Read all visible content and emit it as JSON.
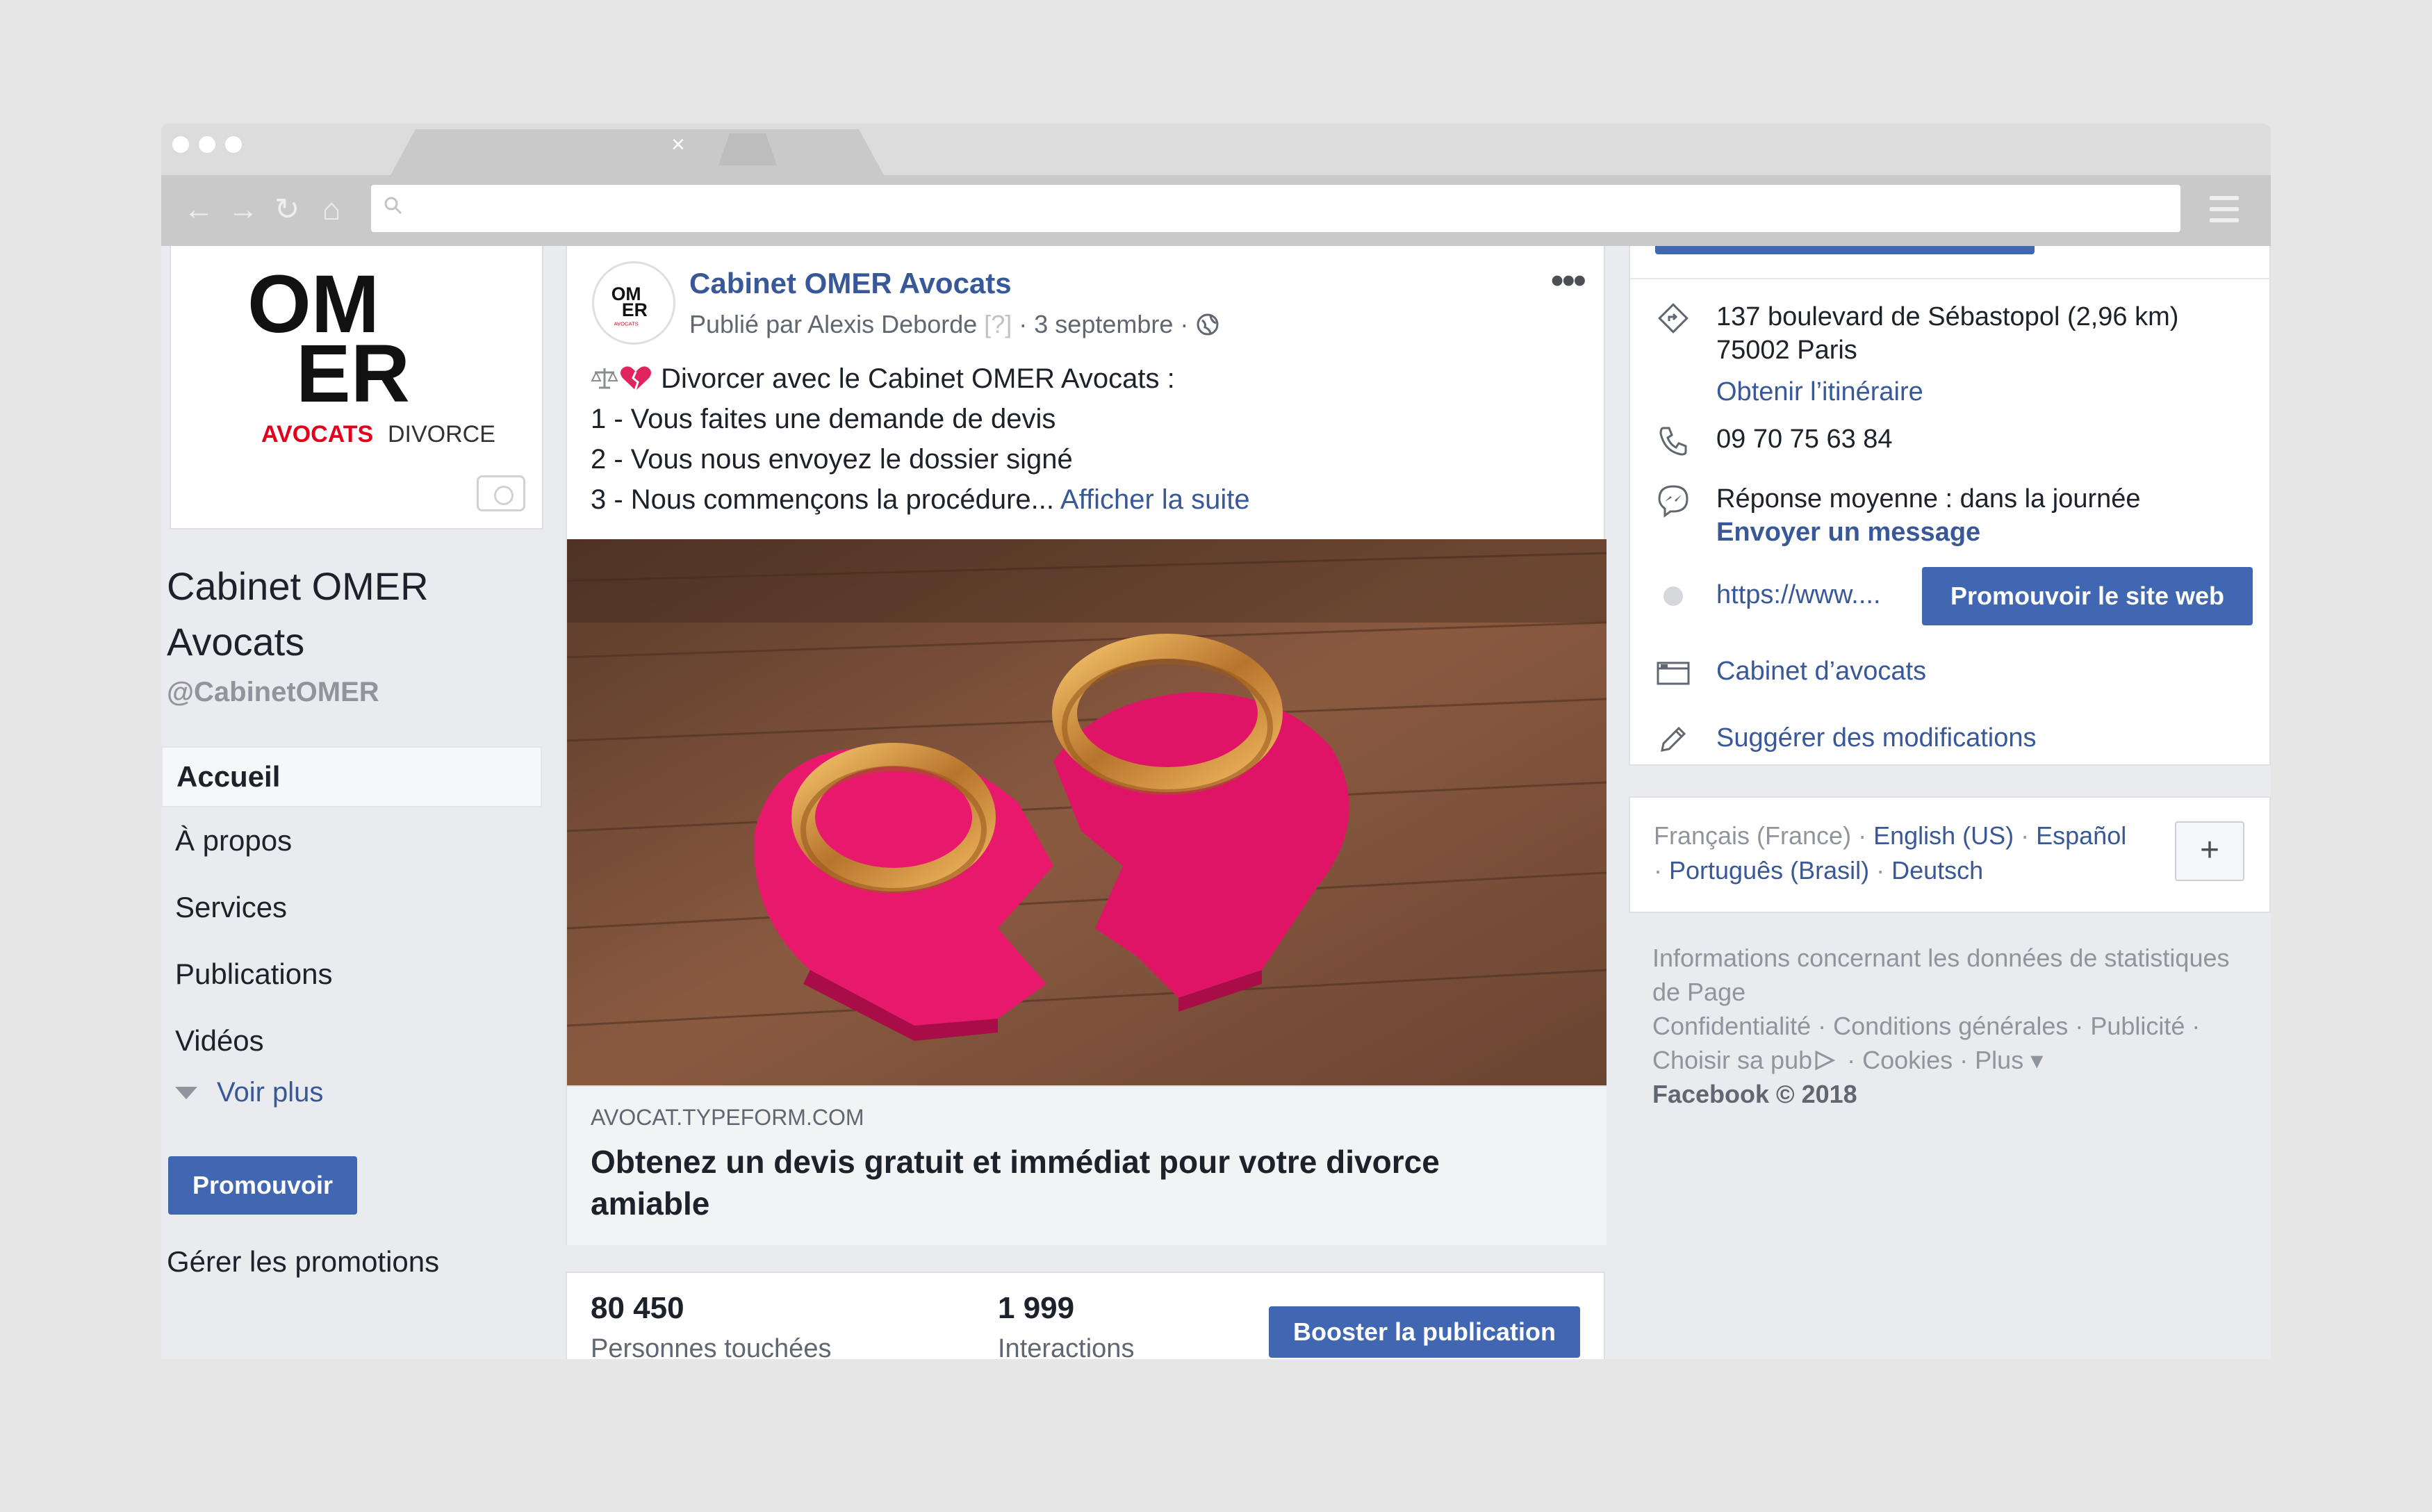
{
  "browser": {
    "tab_close": "×"
  },
  "page": {
    "name": "Cabinet OMER Avocats",
    "handle": "@CabinetOMER",
    "logo": {
      "line1": "OM",
      "line2": "ER",
      "word_red": "AVOCATS",
      "word_black": "DIVORCE"
    }
  },
  "sidebar": {
    "items": [
      {
        "label": "Accueil"
      },
      {
        "label": "À propos"
      },
      {
        "label": "Services"
      },
      {
        "label": "Publications"
      },
      {
        "label": "Vidéos"
      }
    ],
    "see_more": "Voir plus",
    "promote_label": "Promouvoir",
    "manage_promotions": "Gérer les promotions"
  },
  "post": {
    "author": "Cabinet OMER Avocats",
    "published_by": "Publié par Alexis Deborde",
    "help_mark": "[?]",
    "separator": "·",
    "date": "3 septembre",
    "more_menu": "•••",
    "lines": [
      "Divorcer avec le Cabinet OMER Avocats :",
      "1 - Vous faites une demande de devis",
      "2 - Vous nous envoyez le dossier signé",
      "3 - Nous commençons la procédure..."
    ],
    "see_more": "Afficher la suite",
    "link_domain": "AVOCAT.TYPEFORM.COM",
    "link_title": "Obtenez un devis gratuit et immédiat pour votre divorce amiable",
    "stats": [
      {
        "value": "80 450",
        "label": "Personnes touchées"
      },
      {
        "value": "1 999",
        "label": "Interactions"
      }
    ],
    "boost_label": "Booster la publication"
  },
  "info": {
    "address_line1": "137 boulevard de Sébastopol (2,96 km)",
    "address_line2": "75002 Paris",
    "directions": "Obtenir l’itinéraire",
    "phone": "09 70 75 63 84",
    "response": "Réponse moyenne : dans la journée",
    "send_message": "Envoyer un message",
    "website": "https://www....",
    "promote_site": "Promouvoir le site web",
    "category": "Cabinet d’avocats",
    "suggest": "Suggérer des modifications"
  },
  "languages": {
    "current": "Français (France)",
    "sep": " · ",
    "others": [
      "English (US)",
      "Español",
      "Português (Brasil)",
      "Deutsch"
    ],
    "plus": "+"
  },
  "footer": {
    "line1": "Informations concernant les données de statistiques de Page",
    "links": "Confidentialité · Conditions générales · Publicité · Choisir sa pub",
    "links2": " · Cookies · Plus ▾",
    "copyright": "Facebook © 2018"
  },
  "colors": {
    "facebook_blue": "#4267b2",
    "link_blue": "#385898",
    "brand_red": "#e2001a",
    "background": "#e9ebee"
  }
}
